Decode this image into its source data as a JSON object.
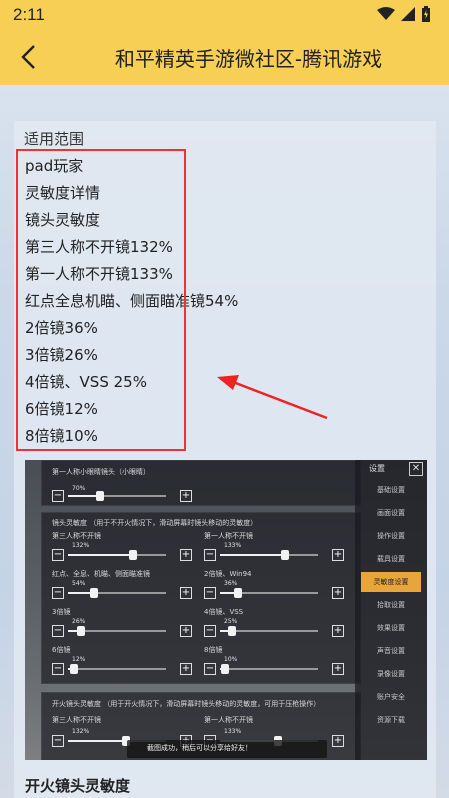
{
  "status": {
    "time": "2:11"
  },
  "header": {
    "title": "和平精英手游微社区-腾讯游戏"
  },
  "article": {
    "section_label": "适用范围",
    "lines": [
      "pad玩家",
      "灵敏度详情",
      "镜头灵敏度",
      "第三人称不开镜132%",
      "第一人称不开镜133%",
      "红点全息机瞄、侧面瞄准镜54%",
      "2倍镜36%",
      "3倍镜26%",
      "4倍镜、VSS 25%",
      "6倍镜12%",
      "8倍镜10%"
    ],
    "bottom_title": "开火镜头灵敏度"
  },
  "game": {
    "top_label": "第一人称小眼睛镜头（小眼睛）",
    "top_value": "70%",
    "panel_title": "镜头灵敏度 （用于不开火情况下，滑动屏幕时镜头移动的灵敏度）",
    "rows": [
      {
        "left_label": "第三人称不开镜",
        "left_value": "132%",
        "left_frac": 0.66,
        "right_label": "第一人称不开镜",
        "right_value": "133%",
        "right_frac": 0.66
      },
      {
        "left_label": "红点、全息、机瞄、侧面瞄准镜",
        "left_value": "54%",
        "left_frac": 0.27,
        "right_label": "2倍镜、Win94",
        "right_value": "36%",
        "right_frac": 0.18
      },
      {
        "left_label": "3倍镜",
        "left_value": "26%",
        "left_frac": 0.13,
        "right_label": "4倍镜、VSS",
        "right_value": "25%",
        "right_frac": 0.12
      },
      {
        "left_label": "6倍镜",
        "left_value": "12%",
        "left_frac": 0.06,
        "right_label": "8倍镜",
        "right_value": "10%",
        "right_frac": 0.05
      }
    ],
    "fire_title": "开火镜头灵敏度 （用于开火情况下，滑动屏幕时镜头移动的灵敏度，可用于压枪操作）",
    "fire_left_label": "第三人称不开镜",
    "fire_left_value": "132%",
    "fire_right_label": "第一人称不开镜",
    "fire_right_value": "133%",
    "side_head": "设置",
    "side_items": [
      "基础设置",
      "画面设置",
      "操作设置",
      "载具设置",
      "灵敏度设置",
      "拾取设置",
      "效果设置",
      "声音设置",
      "录像设置",
      "账户安全",
      "资源下载"
    ],
    "side_active": 4,
    "toast": "截图成功，稍后可以分享给好友！"
  }
}
